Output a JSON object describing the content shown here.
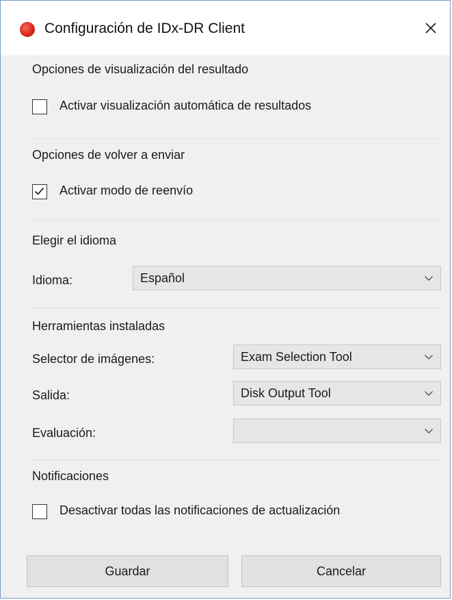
{
  "window": {
    "title": "Configuración de IDx-DR Client"
  },
  "display_section": {
    "title": "Opciones de visualización del resultado",
    "auto_display": {
      "label": "Activar visualización automática de resultados",
      "checked": false
    }
  },
  "resend_section": {
    "title": "Opciones de volver a enviar",
    "resend_mode": {
      "label": "Activar modo de reenvío",
      "checked": true
    }
  },
  "language_section": {
    "title": "Elegir el idioma",
    "language_label": "Idioma:",
    "language_value": "Español"
  },
  "tools_section": {
    "title": "Herramientas instaladas",
    "image_selector_label": "Selector de imágenes:",
    "image_selector_value": "Exam Selection Tool",
    "output_label": "Salida:",
    "output_value": "Disk Output Tool",
    "evaluation_label": "Evaluación:",
    "evaluation_value": ""
  },
  "notifications_section": {
    "title": "Notificaciones",
    "disable_updates": {
      "label": "Desactivar todas las notificaciones de actualización",
      "checked": false
    }
  },
  "buttons": {
    "save_label": "Guardar",
    "cancel_label": "Cancelar"
  },
  "icons": {
    "app": "red-circle-icon",
    "close": "close-icon",
    "check": "checkmark-icon",
    "dropdown": "chevron-down-icon"
  },
  "colors": {
    "app_icon": "#d8281c",
    "window_border": "#7a9cc6",
    "dialog_background": "#f0f0f0"
  }
}
